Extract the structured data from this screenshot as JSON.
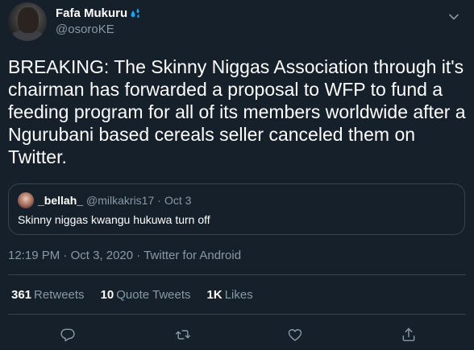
{
  "tweet": {
    "display_name": "Fafa Mukuru",
    "handle": "@osoroKE",
    "body": "BREAKING: The Skinny Niggas Association through it's chairman has forwarded a proposal to WFP to fund a feeding program for all of its members worldwide after a Ngurubani based cereals seller canceled them on Twitter.",
    "quote": {
      "name": "_bellah_",
      "handle": "@milkakris17",
      "dot": "·",
      "date": "Oct 3",
      "text": "Skinny niggas kwangu hukuwa turn off"
    },
    "time": "12:19 PM",
    "date": "Oct 3, 2020",
    "source": "Twitter for Android",
    "separator": " · ",
    "stats": {
      "retweets_count": "361",
      "retweets_label": "Retweets",
      "quotes_count": "10",
      "quotes_label": "Quote Tweets",
      "likes_count": "1K",
      "likes_label": "Likes"
    }
  },
  "icons": {
    "name_badge": "water-drops-icon",
    "menu": "chevron-down-icon",
    "reply": "reply-icon",
    "retweet": "retweet-icon",
    "like": "heart-icon",
    "share": "share-icon"
  },
  "colors": {
    "background": "#15202b",
    "secondary_text": "#8899a6",
    "border": "#38444d",
    "drops": "#1da1f2"
  }
}
